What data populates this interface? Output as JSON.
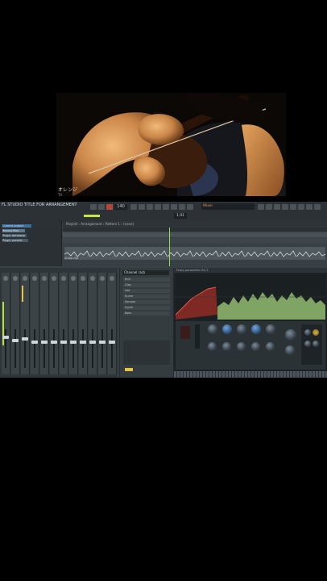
{
  "video": {
    "caption": "オレンジ",
    "caption_sub": "TV"
  },
  "daw": {
    "title": "FL STUDIO TITLE FOR ARRANGEMENT",
    "tempo": "140",
    "song_time": "1:01",
    "lcd_text": "Mixer",
    "playlist_header": "Playlist - Arrangement › Pattern 1 › (none)",
    "clip_label": "Audio clip",
    "channel_rack": {
      "header": "Channel rack",
      "rows": [
        "Kick",
        "Clap",
        "Hat",
        "Snare",
        "Sample",
        "Synth",
        "Bass"
      ]
    },
    "plugin_header": "Fruity parametric EQ 2",
    "browser_items": [
      "Current project",
      "Recent files",
      "Plugin database",
      "Plugin presets"
    ]
  },
  "colors": {
    "accent_green": "#b5e13a",
    "accent_orange": "#e48b5a",
    "panel": "#3a4146"
  }
}
